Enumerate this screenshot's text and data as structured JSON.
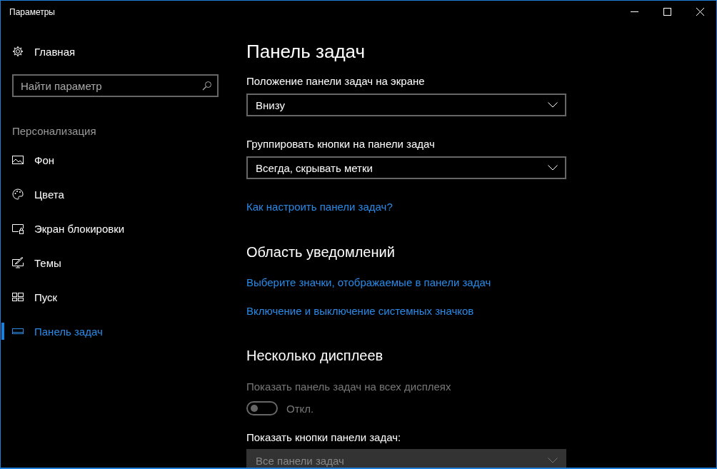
{
  "window": {
    "title": "Параметры"
  },
  "sidebar": {
    "home": "Главная",
    "search": {
      "placeholder": "Найти параметр"
    },
    "section": "Персонализация",
    "items": [
      {
        "label": "Фон",
        "selected": false
      },
      {
        "label": "Цвета",
        "selected": false
      },
      {
        "label": "Экран блокировки",
        "selected": false
      },
      {
        "label": "Темы",
        "selected": false
      },
      {
        "label": "Пуск",
        "selected": false
      },
      {
        "label": "Панель задач",
        "selected": true
      }
    ]
  },
  "content": {
    "title": "Панель задач",
    "items": [
      {
        "kind": "dropdown",
        "label": "Положение панели задач на экране",
        "value": "Внизу",
        "disabled": false
      },
      {
        "kind": "dropdown",
        "label": "Группировать кнопки на панели задач",
        "value": "Всегда, скрывать метки",
        "disabled": false
      },
      {
        "kind": "link",
        "text": "Как настроить панели задач?"
      },
      {
        "kind": "heading",
        "text": "Область уведомлений"
      },
      {
        "kind": "link",
        "text": "Выберите значки, отображаемые в панели задач"
      },
      {
        "kind": "link",
        "text": "Включение и выключение системных значков"
      },
      {
        "kind": "heading",
        "text": "Несколько дисплеев"
      },
      {
        "kind": "toggle",
        "label": "Показать панель задач на всех дисплеях",
        "on": false,
        "state_text": "Откл.",
        "disabled": true
      },
      {
        "kind": "dropdown",
        "label": "Показать кнопки панели задач:",
        "value": "Все панели задач",
        "disabled": true
      }
    ]
  }
}
